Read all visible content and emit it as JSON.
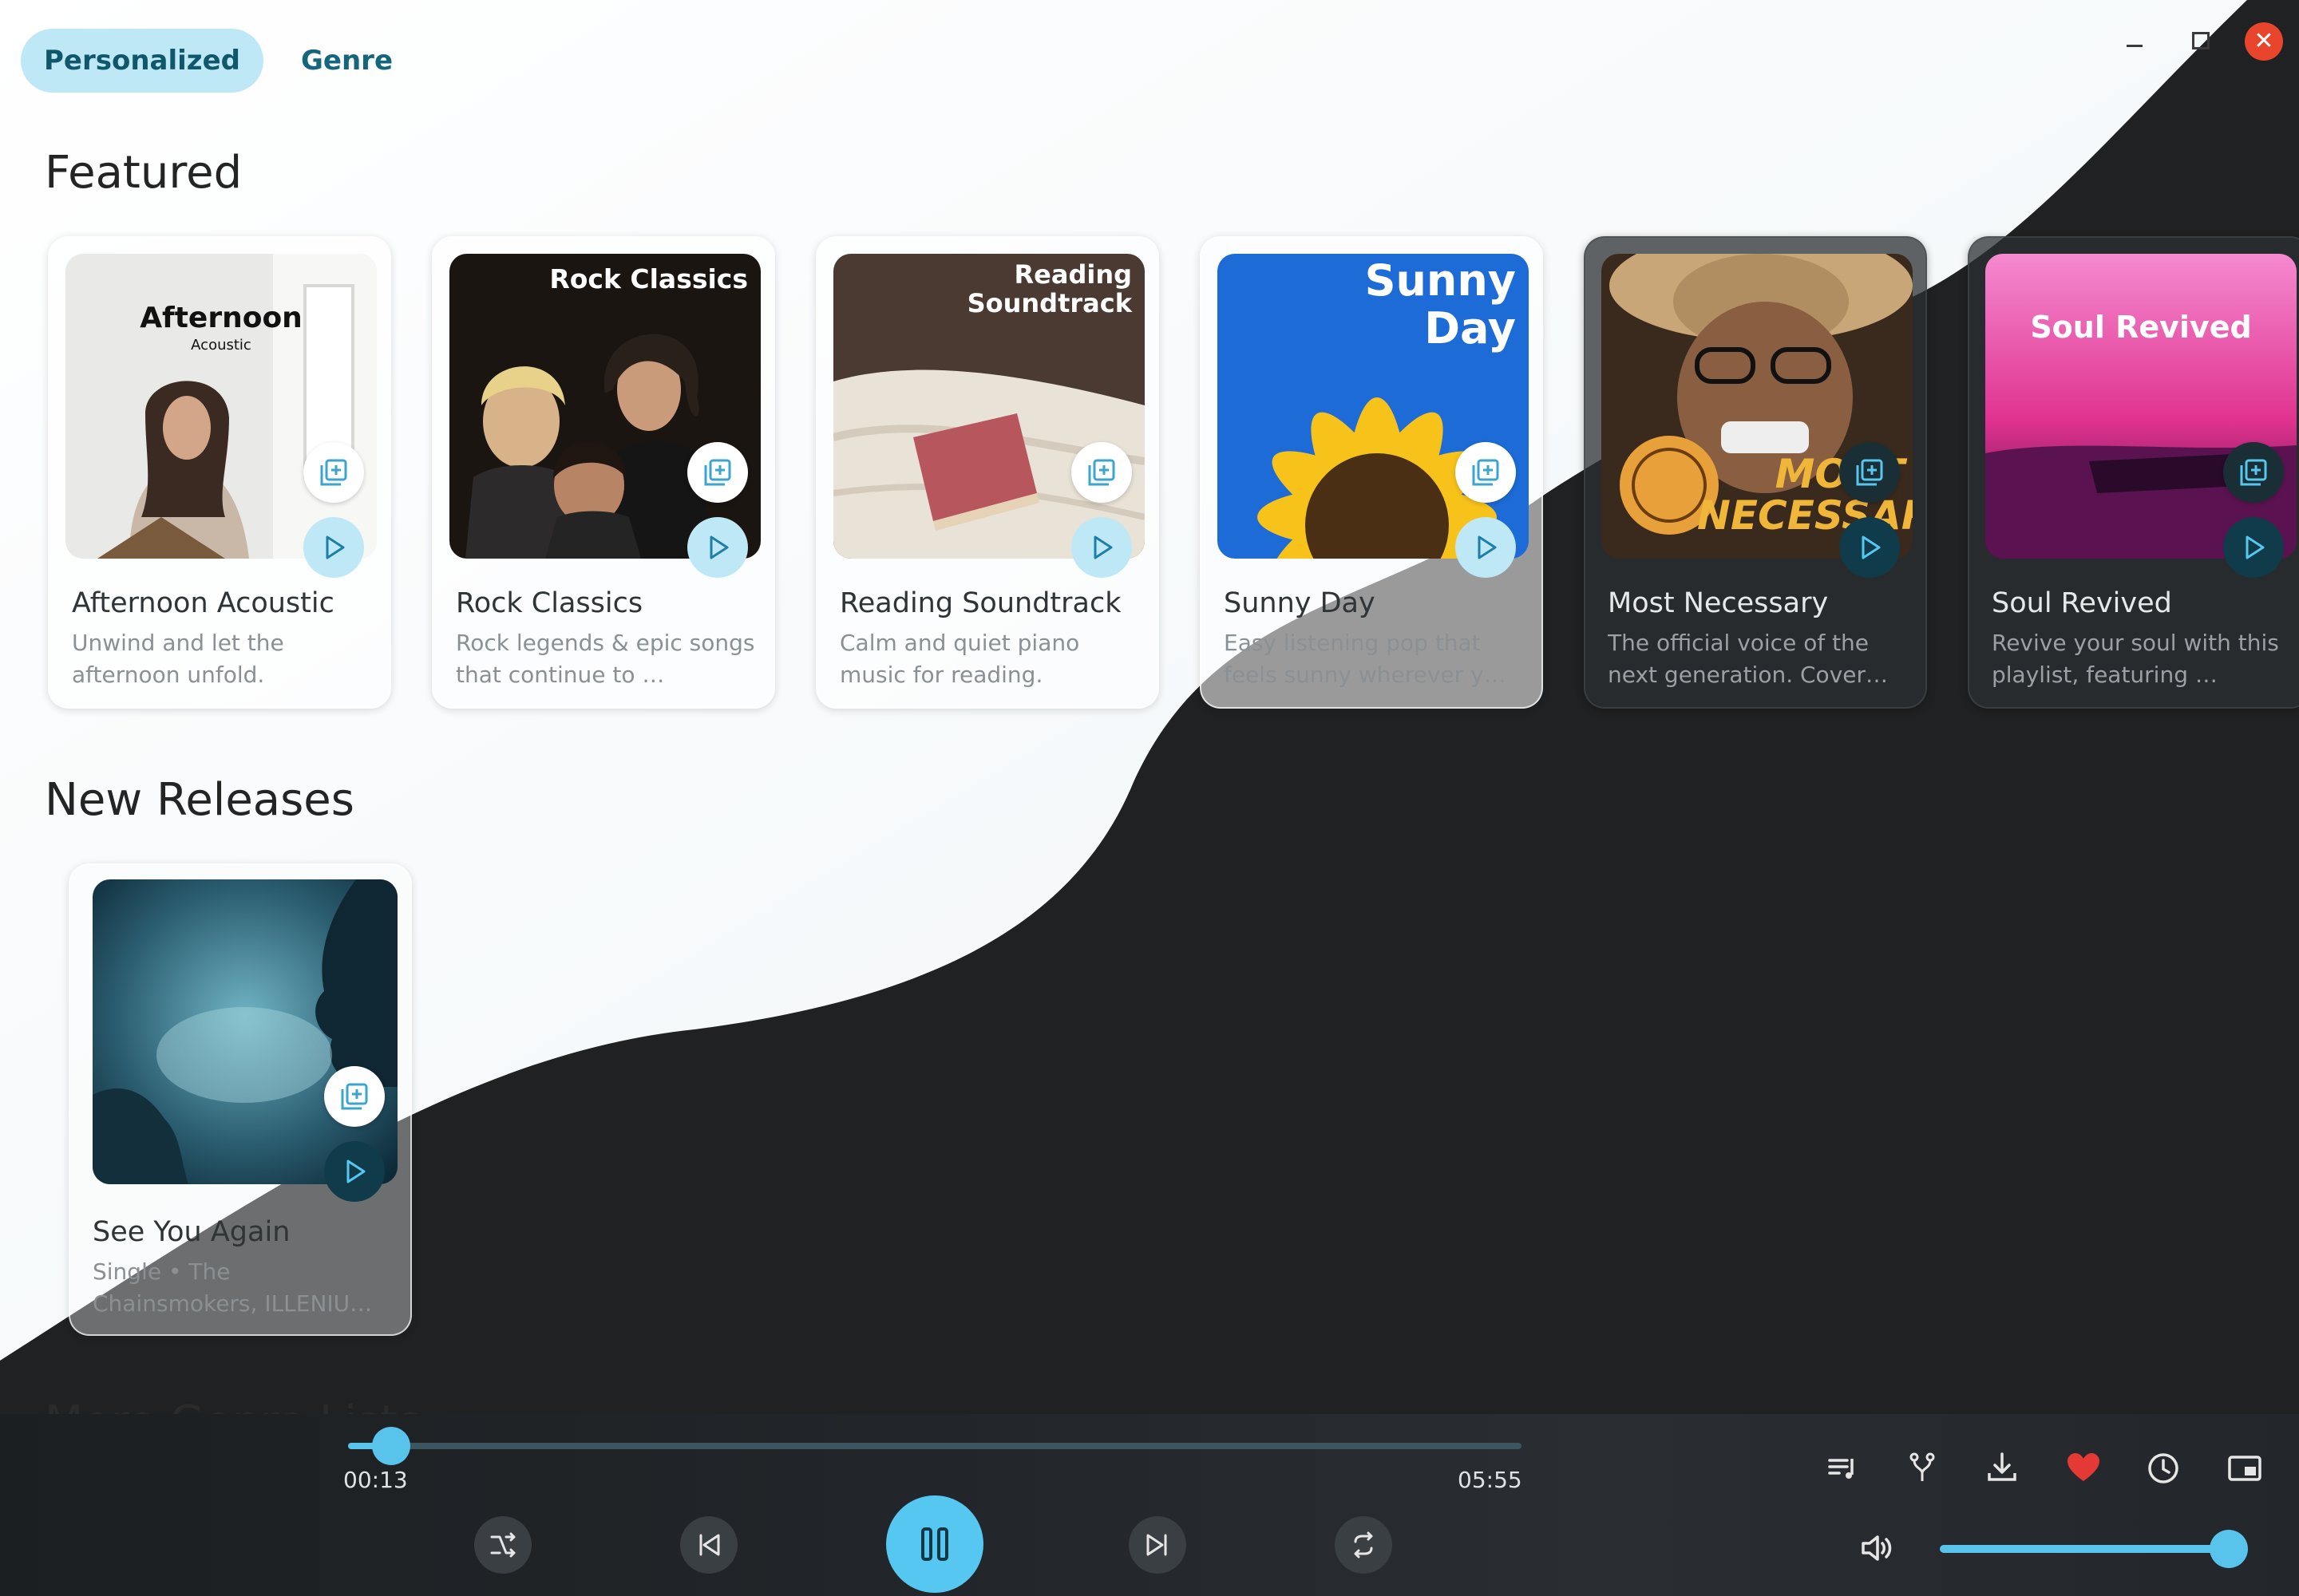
{
  "tabs": [
    {
      "label": "Personalized",
      "active": true
    },
    {
      "label": "Genre",
      "active": false
    }
  ],
  "sections": {
    "featured": "Featured",
    "new_releases": "New Releases",
    "more": "More Genre Lists"
  },
  "featured": [
    {
      "title": "Afternoon Acoustic",
      "description": "Unwind and let the afternoon unfold.",
      "art_title": "Afternoon",
      "art_subtitle": "Acoustic"
    },
    {
      "title": "Rock Classics",
      "description": "Rock legends & epic songs that continue to …",
      "art_title": "Rock Classics"
    },
    {
      "title": "Reading Soundtrack",
      "description": "Calm and quiet piano music for reading.",
      "art_title": "Reading Soundtrack"
    },
    {
      "title": "Sunny Day",
      "description": "Easy listening pop that feels sunny wherever y…",
      "art_title": "Sunny Day"
    },
    {
      "title": "Most Necessary",
      "description": "The official voice of the next generation. Cover…",
      "art_title": "MOST NECESSARY"
    },
    {
      "title": "Soul Revived",
      "description": "Revive your soul with this playlist, featuring …",
      "art_title": "Soul Revived"
    }
  ],
  "new_releases": [
    {
      "title": "See You Again",
      "description": "Single • The Chainsmokers, ILLENIU…"
    }
  ],
  "player": {
    "current_time": "00:13",
    "total_time": "05:55",
    "progress": 0.037,
    "volume": 1.0,
    "favorite": true
  },
  "colors": {
    "accent": "#55c7f0",
    "close": "#e8452c",
    "heart": "#e53935",
    "dark_bg": "#1f2123"
  },
  "icons": {
    "add": "add-to-queue-icon",
    "play": "play-icon",
    "shuffle": "shuffle-icon",
    "previous": "skip-previous-icon",
    "pause": "pause-icon",
    "next": "skip-next-icon",
    "repeat": "repeat-icon",
    "queue": "queue-icon",
    "fork": "fork-icon",
    "download": "download-icon",
    "favorite": "heart-icon",
    "history": "history-icon",
    "mini": "miniplayer-icon",
    "volume": "volume-icon"
  }
}
